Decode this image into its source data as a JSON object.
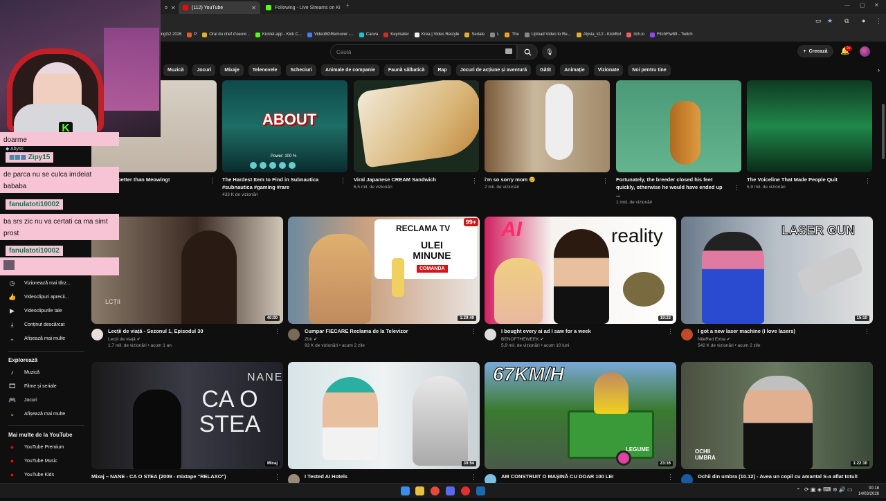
{
  "browser": {
    "tabs": [
      {
        "label": "o"
      },
      {
        "label": "(112) YouTube"
      },
      {
        "label": "Following - Live Streams on Ki"
      }
    ],
    "new_tab": "+",
    "bookmarks": [
      "ningG2 2026",
      "P",
      "Oral du chef d'oeuvr...",
      "Kicklet.app - Kick C...",
      "VideoBGRemover -...",
      "Canva",
      "Keymailer",
      "Krea | Video Restyle",
      "Seriale",
      "L",
      "The",
      "Upload Video to Re...",
      "Alysia_k12 - KickBot",
      "itch.io",
      "FitchFtw89 - Twitch"
    ]
  },
  "youtube": {
    "search_placeholder": "Caută",
    "create_label": "Creează",
    "notif_count": "9+",
    "chips": [
      "Muzică",
      "Jocuri",
      "Mixaje",
      "Telenovele",
      "Scheciuri",
      "Animale de companie",
      "Faună sălbatică",
      "Rap",
      "Jocuri de acțiune și aventură",
      "Gătit",
      "Animație",
      "Vizionate",
      "Noi pentru tine"
    ],
    "shorts": [
      {
        "title": "better than Meowing!",
        "views": ""
      },
      {
        "title": "The Hardest Item to Find in Subnautica #subnautica #gaming #rare",
        "views": "433 K de vizionări",
        "overlay": "ABOUT",
        "power": "Power: 100 %"
      },
      {
        "title": "Viral Japanese CREAM Sandwich",
        "views": "6,5 mil. de vizionări"
      },
      {
        "title": "i'm so sorry mom 😢",
        "views": "2 mil. de vizionări"
      },
      {
        "title": "Fortunately, the breeder closed his feet quickly, otherwise he would have ended up ...",
        "views": "1 mld. de vizionări"
      },
      {
        "title": "The Voiceline That Made People Quit",
        "views": "5,9 mil. de vizionări"
      }
    ],
    "videos_row1": [
      {
        "title": "Lecții de viață - Sezonul 1, Episodul 30",
        "channel": "Lecții de viață",
        "stats": "1,7 mil. de vizionări • acum 1 an",
        "duration": "40:00",
        "thumb_text": "LCȚII"
      },
      {
        "title": "Cumpar FIECARE Reclama de la Televizor",
        "channel": "Zbir",
        "stats": "93 K de vizionări • acum 2 zile",
        "duration": "1:29:49",
        "thumb_text": "RECLAMA TV",
        "thumb_text2": "ULEI MINUNE",
        "thumb_text3": "COMANDA",
        "badge": "99+"
      },
      {
        "title": "I bought every ai ad I saw for a week",
        "channel": "BENOFTHEWEEK",
        "stats": "5,9 mil. de vizionări • acum 10 luni",
        "duration": "19:23",
        "thumb_text": "reality",
        "thumb_text2": "AI"
      },
      {
        "title": "I got a new laser machine (I love lasers)",
        "channel": "NileRed Extra",
        "stats": "542 K de vizionări • acum 2 zile",
        "duration": "15:10",
        "thumb_text": "LASER GUN"
      }
    ],
    "videos_row2": [
      {
        "title": "Mixaj – NANE - CA O STEA (2009 - mixtape \"RELAXO\")",
        "duration": "Mixaj",
        "thumb_text": "NANE",
        "thumb_text2": "CA O STEA"
      },
      {
        "title": "I Tested AI Hotels",
        "duration": "30:54"
      },
      {
        "title": "AM CONSTRUIT O MAȘINĂ CU DOAR 100 LEI",
        "duration": "23:16",
        "thumb_text": "67KM/H",
        "thumb_text2": "LEGUME"
      },
      {
        "title": "Ochii din umbra (10.12) - Avea un copil cu amantal S-a aflat totul!",
        "duration": "1:22:10",
        "thumb_text": "OCHII UMBRA"
      }
    ],
    "sidebar": {
      "items_top": [
        "Vizionează mai târz...",
        "Videoclipuri aprecii...",
        "Videoclipurile tale",
        "Conținut descărcat",
        "Afișează mai multe"
      ],
      "explore_heading": "Explorează",
      "explore": [
        "Muzică",
        "Filme și seriale",
        "Jocuri",
        "Afișează mai multe"
      ],
      "more_heading": "Mai multe de la YouTube",
      "more": [
        "YouTube Premium",
        "YouTube Music",
        "YouTube Kids"
      ]
    }
  },
  "overlay_chat": {
    "messages": [
      {
        "name": "",
        "text": "doarme"
      },
      {
        "name": "Abyss",
        "text": ""
      },
      {
        "name": "Zipy15",
        "text": "de parca nu se culca imdeiat bababa"
      },
      {
        "name": "fanulatoti10002",
        "text": "ba srs zic nu va certati ca ma simt prost"
      },
      {
        "name": "fanulatoti10002",
        "text": ""
      }
    ]
  },
  "taskbar": {
    "time": "00:18",
    "date": "14/03/2026"
  }
}
